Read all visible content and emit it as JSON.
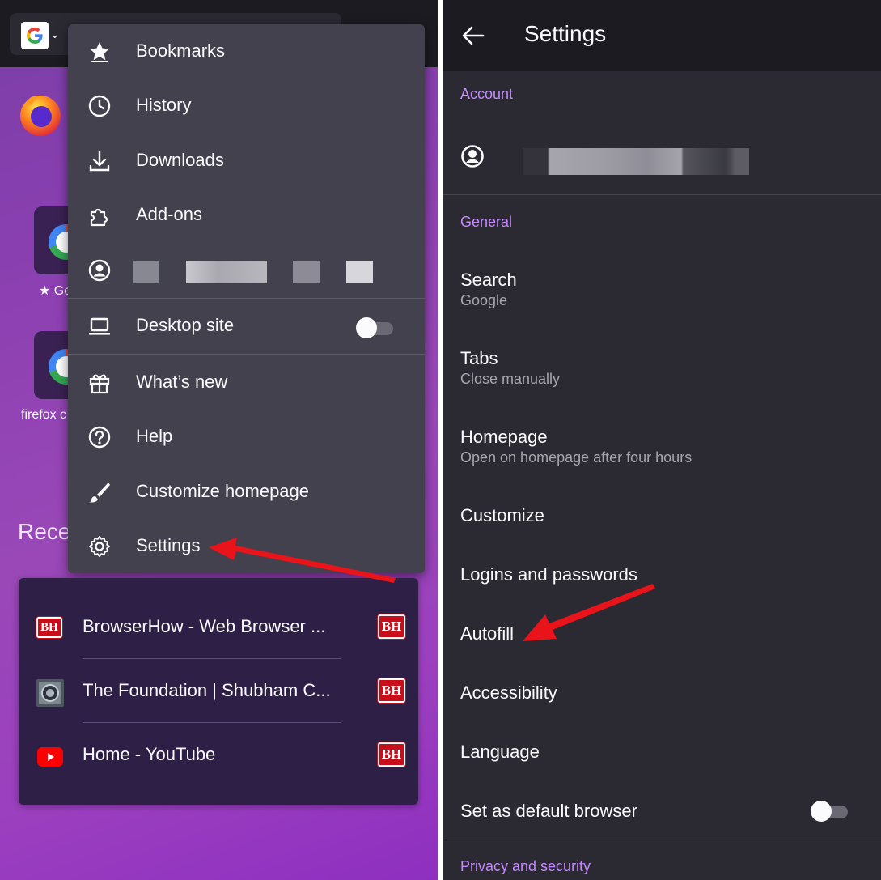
{
  "left": {
    "shortcuts": [
      {
        "label": "★ Go"
      },
      {
        "label": "firefox c"
      }
    ],
    "recent_heading": "Rece",
    "menu": {
      "items": [
        {
          "label": "Bookmarks",
          "icon": "star-icon"
        },
        {
          "label": "History",
          "icon": "clock-icon"
        },
        {
          "label": "Downloads",
          "icon": "download-icon"
        },
        {
          "label": "Add-ons",
          "icon": "puzzle-icon"
        },
        {
          "label": "",
          "icon": "account-icon",
          "redacted": true
        },
        {
          "label": "Desktop site",
          "icon": "laptop-icon",
          "toggle": false
        },
        {
          "label": "What’s new",
          "icon": "gift-icon"
        },
        {
          "label": "Help",
          "icon": "help-icon"
        },
        {
          "label": "Customize homepage",
          "icon": "brush-icon"
        },
        {
          "label": "Settings",
          "icon": "gear-icon"
        }
      ]
    },
    "recent": [
      {
        "title": "BrowserHow - Web Browser ...",
        "favicon": "bh-favicon",
        "badge": "BH"
      },
      {
        "title": "The Foundation | Shubham C...",
        "favicon": "foundation-favicon",
        "badge": "BH"
      },
      {
        "title": "Home - YouTube",
        "favicon": "youtube-favicon",
        "badge": "BH"
      }
    ]
  },
  "right": {
    "title": "Settings",
    "sections": {
      "account": "Account",
      "general": "General",
      "privacy": "Privacy and security"
    },
    "rows": {
      "search": {
        "title": "Search",
        "subtitle": "Google"
      },
      "tabs": {
        "title": "Tabs",
        "subtitle": "Close manually"
      },
      "homepage": {
        "title": "Homepage",
        "subtitle": "Open on homepage after four hours"
      },
      "customize": {
        "title": "Customize"
      },
      "logins": {
        "title": "Logins and passwords"
      },
      "autofill": {
        "title": "Autofill"
      },
      "accessibility": {
        "title": "Accessibility"
      },
      "language": {
        "title": "Language"
      },
      "default_browser": {
        "title": "Set as default browser",
        "toggle": false
      }
    }
  },
  "colors": {
    "menu_bg": "#42414d",
    "settings_bg": "#2b2a33",
    "section_accent": "#c689ff",
    "annotation_arrow": "#e8141a"
  }
}
